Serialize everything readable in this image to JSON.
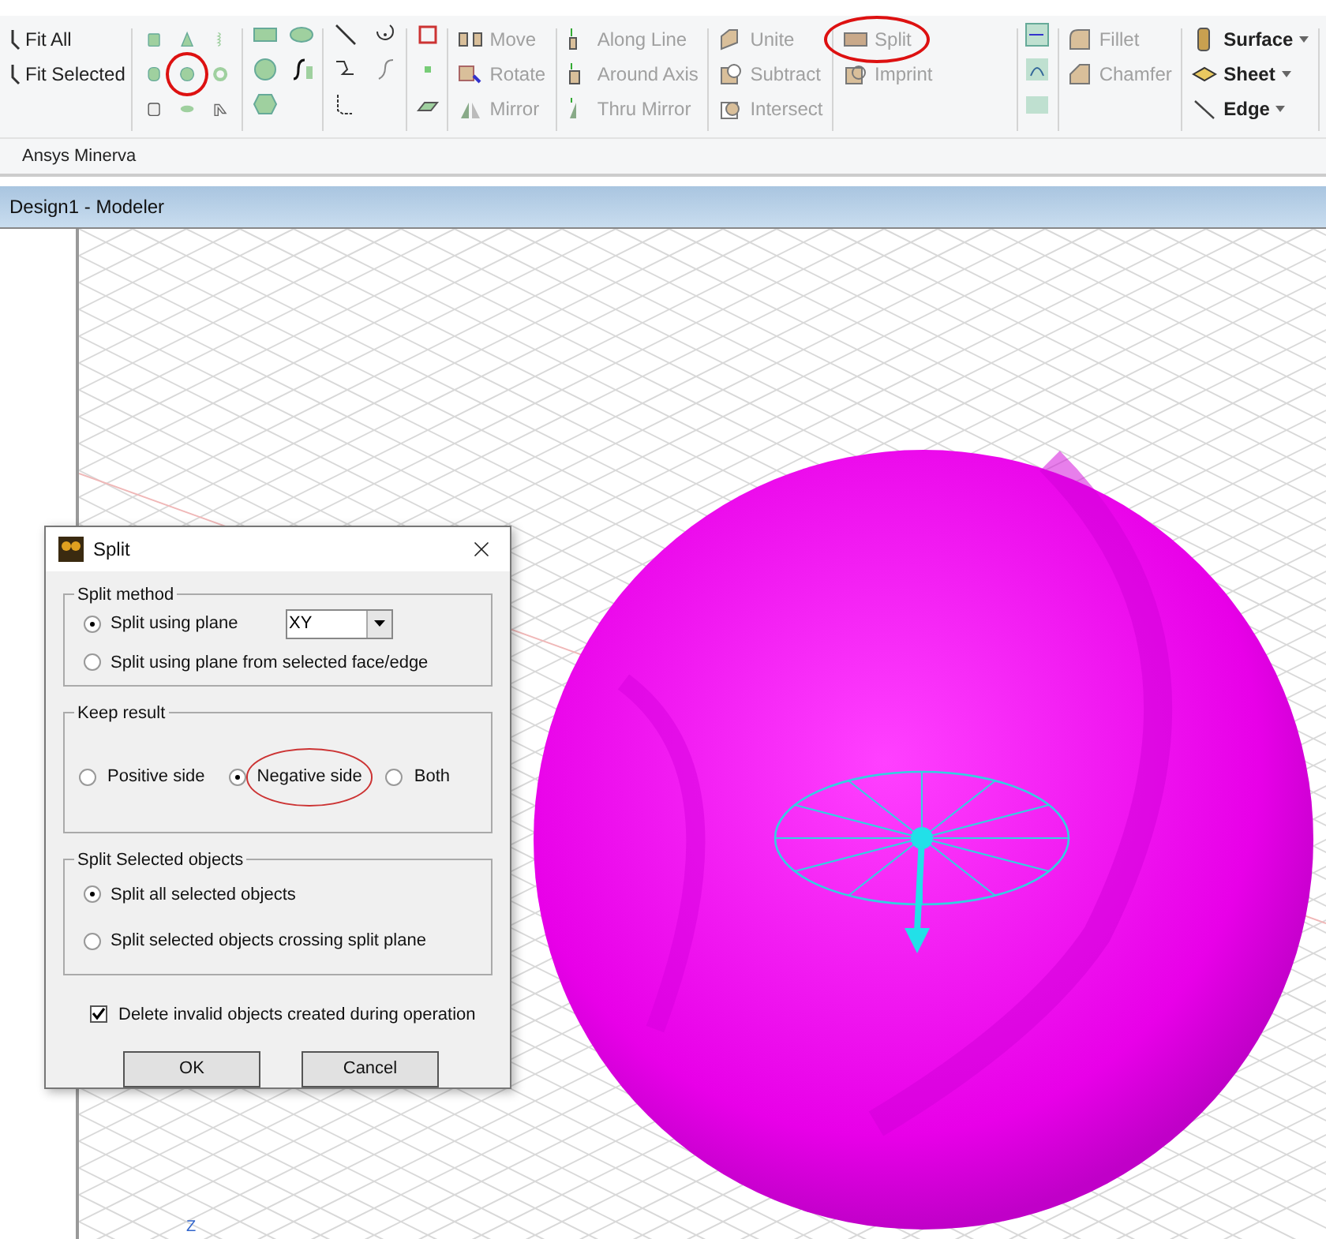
{
  "ribbon": {
    "view_buttons": [
      {
        "label": "Fit All",
        "disabled": false
      },
      {
        "label": "Fit Selected",
        "disabled": false
      }
    ],
    "draw_tools": [
      {
        "circled": false
      },
      {
        "circled": false
      },
      {
        "circled": false
      },
      {
        "circled": false
      },
      {
        "circled": true
      },
      {
        "circled": false
      },
      {
        "circled": false
      },
      {
        "circled": false
      },
      {
        "circled": false
      }
    ],
    "groups": [
      [
        {
          "label": "Move",
          "disabled": true,
          "circled": false
        },
        {
          "label": "Rotate",
          "disabled": true,
          "circled": false
        },
        {
          "label": "Mirror",
          "disabled": true,
          "circled": false
        }
      ],
      [
        {
          "label": "Along Line",
          "disabled": true,
          "circled": false
        },
        {
          "label": "Around Axis",
          "disabled": true,
          "circled": false
        },
        {
          "label": "Thru Mirror",
          "disabled": true,
          "circled": false
        }
      ],
      [
        {
          "label": "Unite",
          "disabled": true,
          "circled": false
        },
        {
          "label": "Subtract",
          "disabled": true,
          "circled": false
        },
        {
          "label": "Intersect",
          "disabled": true,
          "circled": false
        }
      ],
      [
        {
          "label": "Split",
          "disabled": true,
          "circled": true
        },
        {
          "label": "Imprint",
          "disabled": true,
          "circled": false
        }
      ],
      [
        {
          "label": "Fillet",
          "disabled": true,
          "circled": false
        },
        {
          "label": "Chamfer",
          "disabled": true,
          "circled": false
        }
      ],
      [
        {
          "label": "Surface",
          "disabled": false,
          "circled": false
        },
        {
          "label": "Sheet",
          "disabled": false,
          "circled": false
        },
        {
          "label": "Edge",
          "disabled": false,
          "circled": false
        }
      ]
    ],
    "tab_strip_label": "Ansys Minerva"
  },
  "window": {
    "title": "Design1 - Modeler"
  },
  "axis_label": "Z",
  "dialog": {
    "title": "Split",
    "split_method": {
      "legend": "Split method",
      "options": [
        {
          "label": "Split using plane",
          "selected": true
        },
        {
          "label": "Split using plane from selected face/edge",
          "selected": false
        }
      ],
      "plane": "XY"
    },
    "keep_result": {
      "legend": "Keep result",
      "options": [
        {
          "label": "Positive side",
          "selected": false,
          "circled": false
        },
        {
          "label": "Negative side",
          "selected": true,
          "circled": true
        },
        {
          "label": "Both",
          "selected": false,
          "circled": false
        }
      ]
    },
    "split_selected": {
      "legend": "Split Selected objects",
      "options": [
        {
          "label": "Split all selected objects",
          "selected": true
        },
        {
          "label": "Split selected objects crossing split plane",
          "selected": false
        }
      ]
    },
    "delete_invalid": {
      "label": "Delete invalid objects created during operation",
      "checked": true
    },
    "buttons": [
      "OK",
      "Cancel"
    ]
  }
}
